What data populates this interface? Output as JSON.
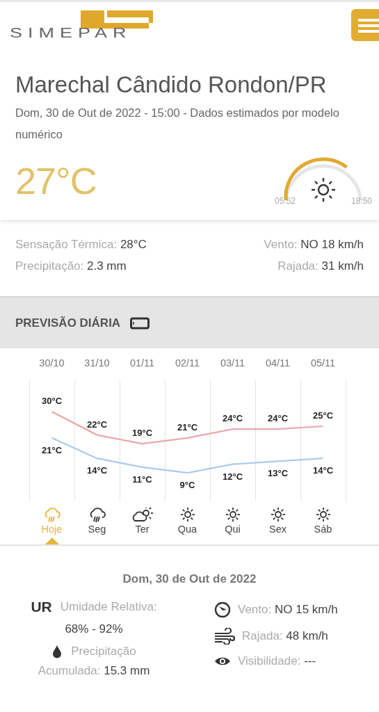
{
  "header": {
    "logo": "SIMEPAR"
  },
  "location": {
    "title": "Marechal Cândido Rondon/PR",
    "subtitle": "Dom, 30 de Out de 2022 - 15:00 - Dados estimados por modelo numérico",
    "temperature": "27°C",
    "sun": {
      "sunrise": "05:52",
      "sunset": "18:50"
    }
  },
  "current": {
    "left": [
      {
        "label": "Sensação Térmica:",
        "value": "28°C"
      },
      {
        "label": "Precipitação:",
        "value": "2.3 mm"
      }
    ],
    "right": [
      {
        "label": "Vento:",
        "value": "NO 18 km/h"
      },
      {
        "label": "Rajada:",
        "value": "31 km/h"
      }
    ]
  },
  "daily": {
    "heading": "PREVISÃO DIÁRIA",
    "chart_data": {
      "type": "line",
      "categories": [
        "30/10",
        "31/10",
        "01/11",
        "02/11",
        "03/11",
        "04/11",
        "05/11"
      ],
      "series": [
        {
          "color": "#eba8aa",
          "values": [
            30,
            22,
            19,
            21,
            24,
            24,
            25
          ],
          "value_labels": [
            "30°C",
            "22°C",
            "19°C",
            "21°C",
            "24°C",
            "24°C",
            "25°C"
          ]
        },
        {
          "color": "#aacbea",
          "values": [
            21,
            14,
            11,
            9,
            12,
            13,
            14
          ],
          "value_labels": [
            "21°C",
            "14°C",
            "11°C",
            "9°C",
            "12°C",
            "13°C",
            "14°C"
          ]
        }
      ]
    },
    "days": [
      {
        "weekday": "Hoje",
        "kind": "rain",
        "selected": true
      },
      {
        "weekday": "Seg",
        "kind": "rain",
        "selected": false
      },
      {
        "weekday": "Ter",
        "kind": "cloud_sun",
        "selected": false
      },
      {
        "weekday": "Qua",
        "kind": "sun",
        "selected": false
      },
      {
        "weekday": "Qui",
        "kind": "sun",
        "selected": false
      },
      {
        "weekday": "Sex",
        "kind": "sun",
        "selected": false
      },
      {
        "weekday": "Sáb",
        "kind": "sun",
        "selected": false
      }
    ]
  },
  "detail": {
    "date": "Dom, 30 de Out de 2022",
    "humidity": {
      "badge": "UR",
      "label": "Umidade Relativa:",
      "value": "68% - 92%"
    },
    "precipitation": {
      "label": "Precipitação",
      "label2": "Acumulada:",
      "value": "15.3 mm"
    },
    "right": [
      {
        "kind": "compass",
        "label": "Vento:",
        "value": "NO 15 km/h"
      },
      {
        "kind": "wind",
        "label": "Rajada:",
        "value": "48 km/h"
      },
      {
        "kind": "eye",
        "label": "Visibilidade:",
        "value": "---"
      }
    ]
  }
}
